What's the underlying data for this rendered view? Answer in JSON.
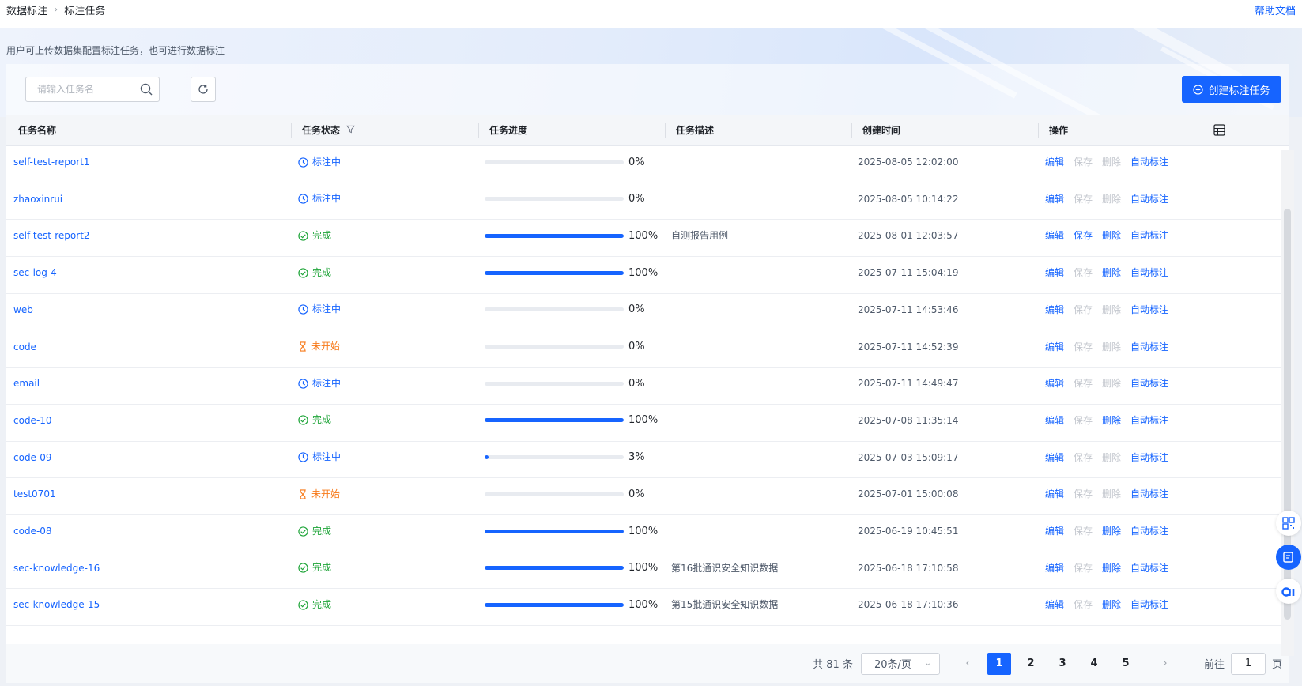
{
  "breadcrumb": {
    "root": "数据标注",
    "current": "标注任务"
  },
  "help_link": "帮助文档",
  "subtitle": "用户可上传数据集配置标注任务，也可进行数据标注",
  "search": {
    "placeholder": "请输入任务名"
  },
  "create_button": "创建标注任务",
  "columns": {
    "name": "任务名称",
    "status": "任务状态",
    "progress": "任务进度",
    "desc": "任务描述",
    "created": "创建时间",
    "ops": "操作"
  },
  "actions": {
    "edit": "编辑",
    "save": "保存",
    "delete": "删除",
    "auto": "自动标注"
  },
  "colors": {
    "accent": "#1664ff",
    "done": "#20a53a",
    "waiting": "#f77a1a",
    "disabled": "#c3c7ce"
  },
  "rows": [
    {
      "name": "self-test-report1",
      "status": "标注中",
      "status_type": "labeling",
      "progress": 0,
      "progress_text": "0%",
      "desc": "",
      "created": "2025-08-05 12:02:00",
      "save_enabled": false,
      "delete_enabled": false
    },
    {
      "name": "zhaoxinrui",
      "status": "标注中",
      "status_type": "labeling",
      "progress": 0,
      "progress_text": "0%",
      "desc": "",
      "created": "2025-08-05 10:14:22",
      "save_enabled": false,
      "delete_enabled": false
    },
    {
      "name": "self-test-report2",
      "status": "完成",
      "status_type": "done",
      "progress": 100,
      "progress_text": "100%",
      "desc": "自测报告用例",
      "created": "2025-08-01 12:03:57",
      "save_enabled": true,
      "delete_enabled": true
    },
    {
      "name": "sec-log-4",
      "status": "完成",
      "status_type": "done",
      "progress": 100,
      "progress_text": "100%",
      "desc": "",
      "created": "2025-07-11 15:04:19",
      "save_enabled": false,
      "delete_enabled": true
    },
    {
      "name": "web",
      "status": "标注中",
      "status_type": "labeling",
      "progress": 0,
      "progress_text": "0%",
      "desc": "",
      "created": "2025-07-11 14:53:46",
      "save_enabled": false,
      "delete_enabled": false
    },
    {
      "name": "code",
      "status": "未开始",
      "status_type": "waiting",
      "progress": 0,
      "progress_text": "0%",
      "desc": "",
      "created": "2025-07-11 14:52:39",
      "save_enabled": false,
      "delete_enabled": false
    },
    {
      "name": "email",
      "status": "标注中",
      "status_type": "labeling",
      "progress": 0,
      "progress_text": "0%",
      "desc": "",
      "created": "2025-07-11 14:49:47",
      "save_enabled": false,
      "delete_enabled": false
    },
    {
      "name": "code-10",
      "status": "完成",
      "status_type": "done",
      "progress": 100,
      "progress_text": "100%",
      "desc": "",
      "created": "2025-07-08 11:35:14",
      "save_enabled": false,
      "delete_enabled": true
    },
    {
      "name": "code-09",
      "status": "标注中",
      "status_type": "labeling",
      "progress": 3,
      "progress_text": "3%",
      "desc": "",
      "created": "2025-07-03 15:09:17",
      "save_enabled": false,
      "delete_enabled": false
    },
    {
      "name": "test0701",
      "status": "未开始",
      "status_type": "waiting",
      "progress": 0,
      "progress_text": "0%",
      "desc": "",
      "created": "2025-07-01 15:00:08",
      "save_enabled": false,
      "delete_enabled": false
    },
    {
      "name": "code-08",
      "status": "完成",
      "status_type": "done",
      "progress": 100,
      "progress_text": "100%",
      "desc": "",
      "created": "2025-06-19 10:45:51",
      "save_enabled": false,
      "delete_enabled": true
    },
    {
      "name": "sec-knowledge-16",
      "status": "完成",
      "status_type": "done",
      "progress": 100,
      "progress_text": "100%",
      "desc": "第16批通识安全知识数据",
      "created": "2025-06-18 17:10:58",
      "save_enabled": false,
      "delete_enabled": true
    },
    {
      "name": "sec-knowledge-15",
      "status": "完成",
      "status_type": "done",
      "progress": 100,
      "progress_text": "100%",
      "desc": "第15批通识安全知识数据",
      "created": "2025-06-18 17:10:36",
      "save_enabled": false,
      "delete_enabled": true
    }
  ],
  "pagination": {
    "total_text": "共 81 条",
    "page_size": "20条/页",
    "pages": [
      "1",
      "2",
      "3",
      "4",
      "5"
    ],
    "current_page": "1",
    "goto_label": "前往",
    "goto_value": "1",
    "goto_suffix": "页"
  }
}
